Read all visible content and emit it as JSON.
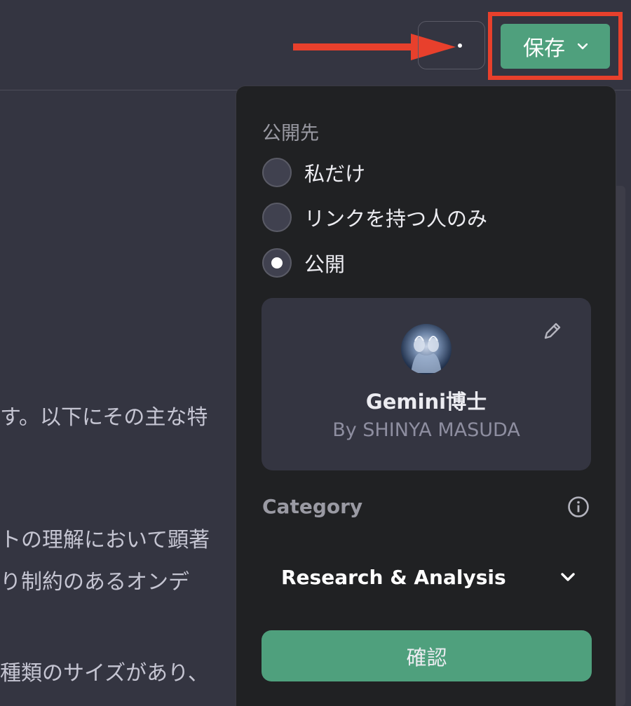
{
  "header": {
    "save_label": "保存",
    "more_icon": "dot-icon",
    "save_color": "#4fa07d",
    "highlight_color": "#e8402c"
  },
  "background_text": [
    "す。以下にその主な特",
    "トの理解において顕著",
    "り制約のあるオンデ",
    "種類のサイズがあり、"
  ],
  "publish_panel": {
    "visibility_label": "公開先",
    "options": [
      {
        "label": "私だけ",
        "checked": false
      },
      {
        "label": "リンクを持つ人のみ",
        "checked": false
      },
      {
        "label": "公開",
        "checked": true
      }
    ],
    "gpt": {
      "name": "Gemini博士",
      "author": "By SHINYA MASUDA"
    },
    "category": {
      "label": "Category",
      "value": "Research & Analysis"
    },
    "confirm_label": "確認"
  }
}
